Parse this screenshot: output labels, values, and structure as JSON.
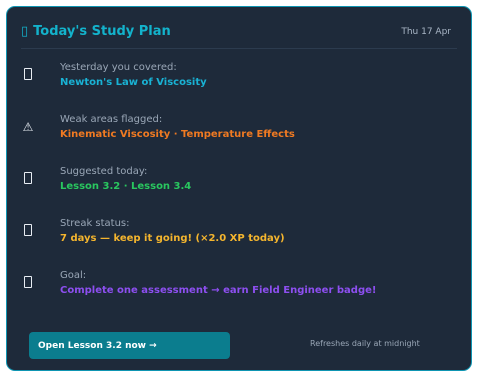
{
  "header": {
    "icon": "calendar-icon",
    "title": "Today's Study Plan",
    "date": "Thu 17 Apr"
  },
  "items": [
    {
      "icon": "book-icon",
      "label": "Yesterday you covered:",
      "value": "Newton's Law of Viscosity",
      "color": "#19b2d4"
    },
    {
      "icon": "warning-icon",
      "label": "Weak areas flagged:",
      "value": "Kinematic Viscosity · Temperature Effects",
      "color": "#f07a22"
    },
    {
      "icon": "clipboard-icon",
      "label": "Suggested today:",
      "value": "Lesson 3.2 · Lesson 3.4",
      "color": "#29c75f"
    },
    {
      "icon": "fire-icon",
      "label": "Streak status:",
      "value": "7 days — keep it going! (×2.0 XP today)",
      "color": "#f4b52e"
    },
    {
      "icon": "target-icon",
      "label": "Goal:",
      "value": "Complete one assessment → earn Field Engineer badge!",
      "color": "#8d4ff0"
    }
  ],
  "footer": {
    "cta_label": "Open Lesson 3.2 now →",
    "refresh_note": "Refreshes daily at midnight"
  },
  "colors": {
    "card_background": "#1e2a3a",
    "card_border": "#0e95b2",
    "title": "#13b3cc",
    "cta_background": "#0b7d8e"
  }
}
